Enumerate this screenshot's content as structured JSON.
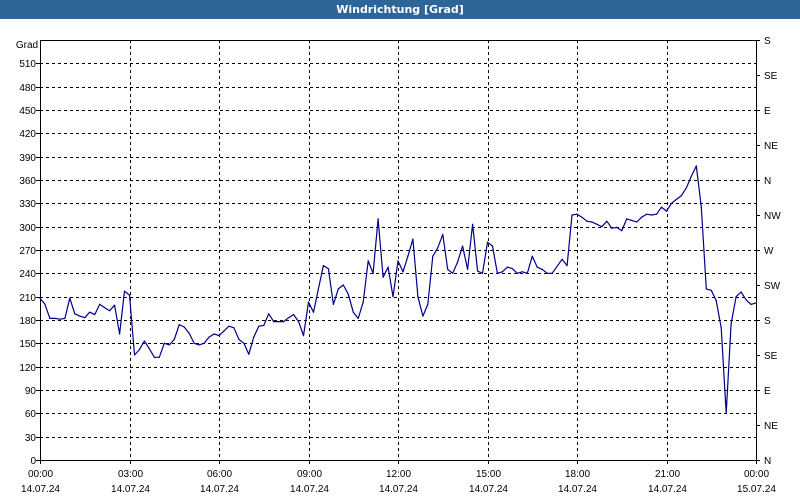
{
  "window": {
    "title": "Windrichtung [Grad]"
  },
  "chart_data": {
    "type": "line",
    "title": "Windrichtung [Grad]",
    "ylabel": "Grad",
    "ylim": [
      0,
      540
    ],
    "y_ticks": [
      0,
      30,
      60,
      90,
      120,
      150,
      180,
      210,
      240,
      270,
      300,
      330,
      360,
      390,
      420,
      450,
      480,
      510
    ],
    "y2_ticks": [
      {
        "value": 0,
        "label": "N"
      },
      {
        "value": 45,
        "label": "NE"
      },
      {
        "value": 90,
        "label": "E"
      },
      {
        "value": 135,
        "label": "SE"
      },
      {
        "value": 180,
        "label": "S"
      },
      {
        "value": 225,
        "label": "SW"
      },
      {
        "value": 270,
        "label": "W"
      },
      {
        "value": 315,
        "label": "NW"
      },
      {
        "value": 360,
        "label": "N"
      },
      {
        "value": 405,
        "label": "NE"
      },
      {
        "value": 450,
        "label": "E"
      },
      {
        "value": 495,
        "label": "SE"
      },
      {
        "value": 540,
        "label": "S"
      }
    ],
    "xlim": [
      "14.07.24 00:00",
      "15.07.24 00:00"
    ],
    "x_ticks": [
      {
        "time": "00:00",
        "date": "14.07.24"
      },
      {
        "time": "03:00",
        "date": "14.07.24"
      },
      {
        "time": "06:00",
        "date": "14.07.24"
      },
      {
        "time": "09:00",
        "date": "14.07.24"
      },
      {
        "time": "12:00",
        "date": "14.07.24"
      },
      {
        "time": "15:00",
        "date": "14.07.24"
      },
      {
        "time": "18:00",
        "date": "14.07.24"
      },
      {
        "time": "21:00",
        "date": "14.07.24"
      },
      {
        "time": "00:00",
        "date": "15.07.24"
      }
    ],
    "grid": true,
    "series": [
      {
        "color": "#00008b",
        "x": [
          "00:00",
          "00:10",
          "00:20",
          "00:30",
          "00:40",
          "00:50",
          "01:00",
          "01:10",
          "01:20",
          "01:30",
          "01:40",
          "01:50",
          "02:00",
          "02:10",
          "02:20",
          "02:30",
          "02:40",
          "02:50",
          "03:00",
          "03:10",
          "03:20",
          "03:30",
          "03:40",
          "03:50",
          "04:00",
          "04:10",
          "04:20",
          "04:30",
          "04:40",
          "04:50",
          "05:00",
          "05:10",
          "05:20",
          "05:30",
          "05:40",
          "05:50",
          "06:00",
          "06:10",
          "06:20",
          "06:30",
          "06:40",
          "06:50",
          "07:00",
          "07:10",
          "07:20",
          "07:30",
          "07:40",
          "07:50",
          "08:00",
          "08:10",
          "08:20",
          "08:30",
          "08:40",
          "08:50",
          "09:00",
          "09:10",
          "09:20",
          "09:30",
          "09:40",
          "09:50",
          "10:00",
          "10:10",
          "10:20",
          "10:30",
          "10:40",
          "10:50",
          "11:00",
          "11:10",
          "11:20",
          "11:30",
          "11:40",
          "11:50",
          "12:00",
          "12:10",
          "12:20",
          "12:30",
          "12:40",
          "12:50",
          "13:00",
          "13:10",
          "13:20",
          "13:30",
          "13:40",
          "13:50",
          "14:00",
          "14:10",
          "14:20",
          "14:30",
          "14:40",
          "14:50",
          "15:00",
          "15:10",
          "15:20",
          "15:30",
          "15:40",
          "15:50",
          "16:00",
          "16:10",
          "16:20",
          "16:30",
          "16:40",
          "16:50",
          "17:00",
          "17:10",
          "17:20",
          "17:30",
          "17:40",
          "17:50",
          "18:00",
          "18:10",
          "18:20",
          "18:30",
          "18:40",
          "18:50",
          "19:00",
          "19:10",
          "19:20",
          "19:30",
          "19:40",
          "19:50",
          "20:00",
          "20:10",
          "20:20",
          "20:30",
          "20:40",
          "20:50",
          "21:00",
          "21:10",
          "21:20",
          "21:30",
          "21:40",
          "21:50",
          "22:00",
          "22:10",
          "22:20",
          "22:30",
          "22:40",
          "22:50",
          "23:00",
          "23:10",
          "23:20",
          "23:30",
          "23:40",
          "23:50",
          "24:00"
        ],
        "y": [
          208,
          200,
          182,
          182,
          181,
          182,
          208,
          188,
          185,
          183,
          190,
          187,
          200,
          196,
          192,
          199,
          162,
          217,
          212,
          135,
          142,
          153,
          143,
          132,
          132,
          150,
          148,
          155,
          174,
          171,
          163,
          150,
          148,
          150,
          158,
          162,
          160,
          166,
          172,
          170,
          155,
          150,
          136,
          158,
          172,
          173,
          188,
          178,
          178,
          178,
          183,
          187,
          178,
          160,
          203,
          190,
          220,
          250,
          246,
          200,
          220,
          225,
          213,
          190,
          182,
          203,
          256,
          240,
          310,
          235,
          248,
          210,
          256,
          242,
          262,
          284,
          210,
          185,
          200,
          262,
          273,
          290,
          245,
          240,
          255,
          275,
          245,
          303,
          243,
          240,
          280,
          275,
          240,
          242,
          248,
          246,
          240,
          242,
          240,
          262,
          248,
          245,
          240,
          240,
          249,
          258,
          250,
          315,
          316,
          312,
          307,
          306,
          303,
          300,
          307,
          298,
          299,
          295,
          310,
          308,
          306,
          312,
          316,
          315,
          316,
          325,
          320,
          330,
          335,
          340,
          350,
          365,
          378,
          325,
          220,
          218,
          205,
          170,
          60,
          175,
          210,
          216,
          206,
          200,
          202
        ]
      }
    ]
  }
}
